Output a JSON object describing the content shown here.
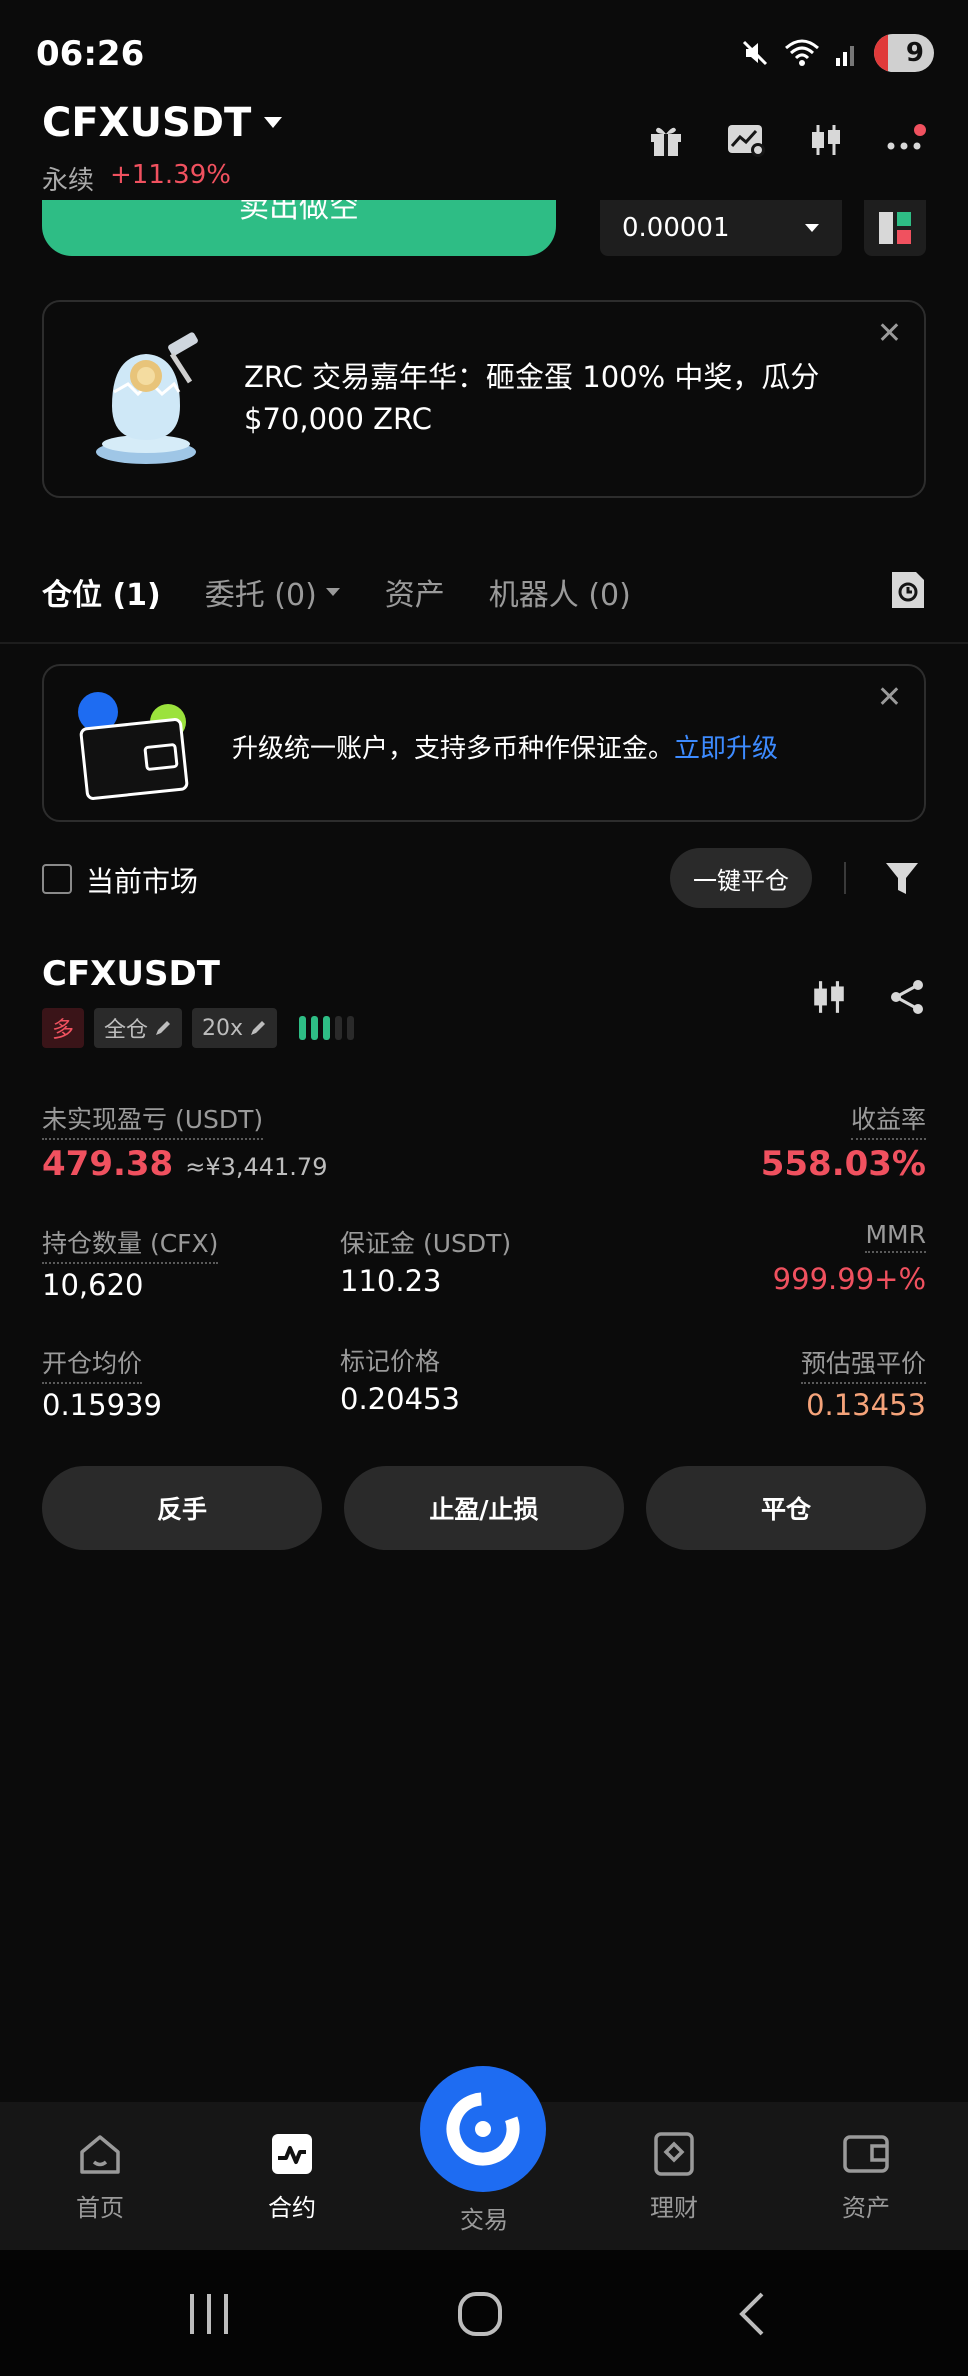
{
  "status_bar": {
    "time": "06:26",
    "battery": "9"
  },
  "header": {
    "symbol": "CFXUSDT",
    "contract_type": "永续",
    "change_pct": "+11.39%"
  },
  "order": {
    "sell_label": "卖出做空",
    "price_step": "0.00001"
  },
  "promo": {
    "text": "ZRC 交易嘉年华：砸金蛋 100% 中奖，瓜分 $70,000 ZRC"
  },
  "tabs": [
    {
      "label": "仓位 (1)"
    },
    {
      "label": "委托 (0)"
    },
    {
      "label": "资产"
    },
    {
      "label": "机器人 (0)"
    }
  ],
  "upgrade": {
    "text": "升级统一账户，支持多币种作保证金。",
    "link": "立即升级"
  },
  "filter": {
    "current_market": "当前市场",
    "close_all": "一键平仓"
  },
  "position": {
    "symbol": "CFXUSDT",
    "side": "多",
    "margin_mode": "全仓",
    "leverage": "20x",
    "leverage_level": 0.6,
    "unrealized_pnl_label": "未实现盈亏 (USDT)",
    "unrealized_pnl": "479.38",
    "unrealized_pnl_cny": "≈¥3,441.79",
    "roe_label": "收益率",
    "roe": "558.03%",
    "qty_label": "持仓数量 (CFX)",
    "qty": "10,620",
    "margin_label": "保证金 (USDT)",
    "margin": "110.23",
    "mmr_label": "MMR",
    "mmr": "999.99+%",
    "entry_label": "开仓均价",
    "entry": "0.15939",
    "mark_label": "标记价格",
    "mark": "0.20453",
    "liq_label": "预估强平价",
    "liq": "0.13453"
  },
  "actions": {
    "reverse": "反手",
    "tpsl": "止盈/止损",
    "close": "平仓"
  },
  "nav": [
    {
      "label": "首页"
    },
    {
      "label": "合约"
    },
    {
      "label": "交易"
    },
    {
      "label": "理财"
    },
    {
      "label": "资产"
    }
  ],
  "colors": {
    "up_green": "#2ebd85",
    "down_red": "#f0515f",
    "link_blue": "#3d8bff",
    "liq_orange": "#f5a37a"
  }
}
